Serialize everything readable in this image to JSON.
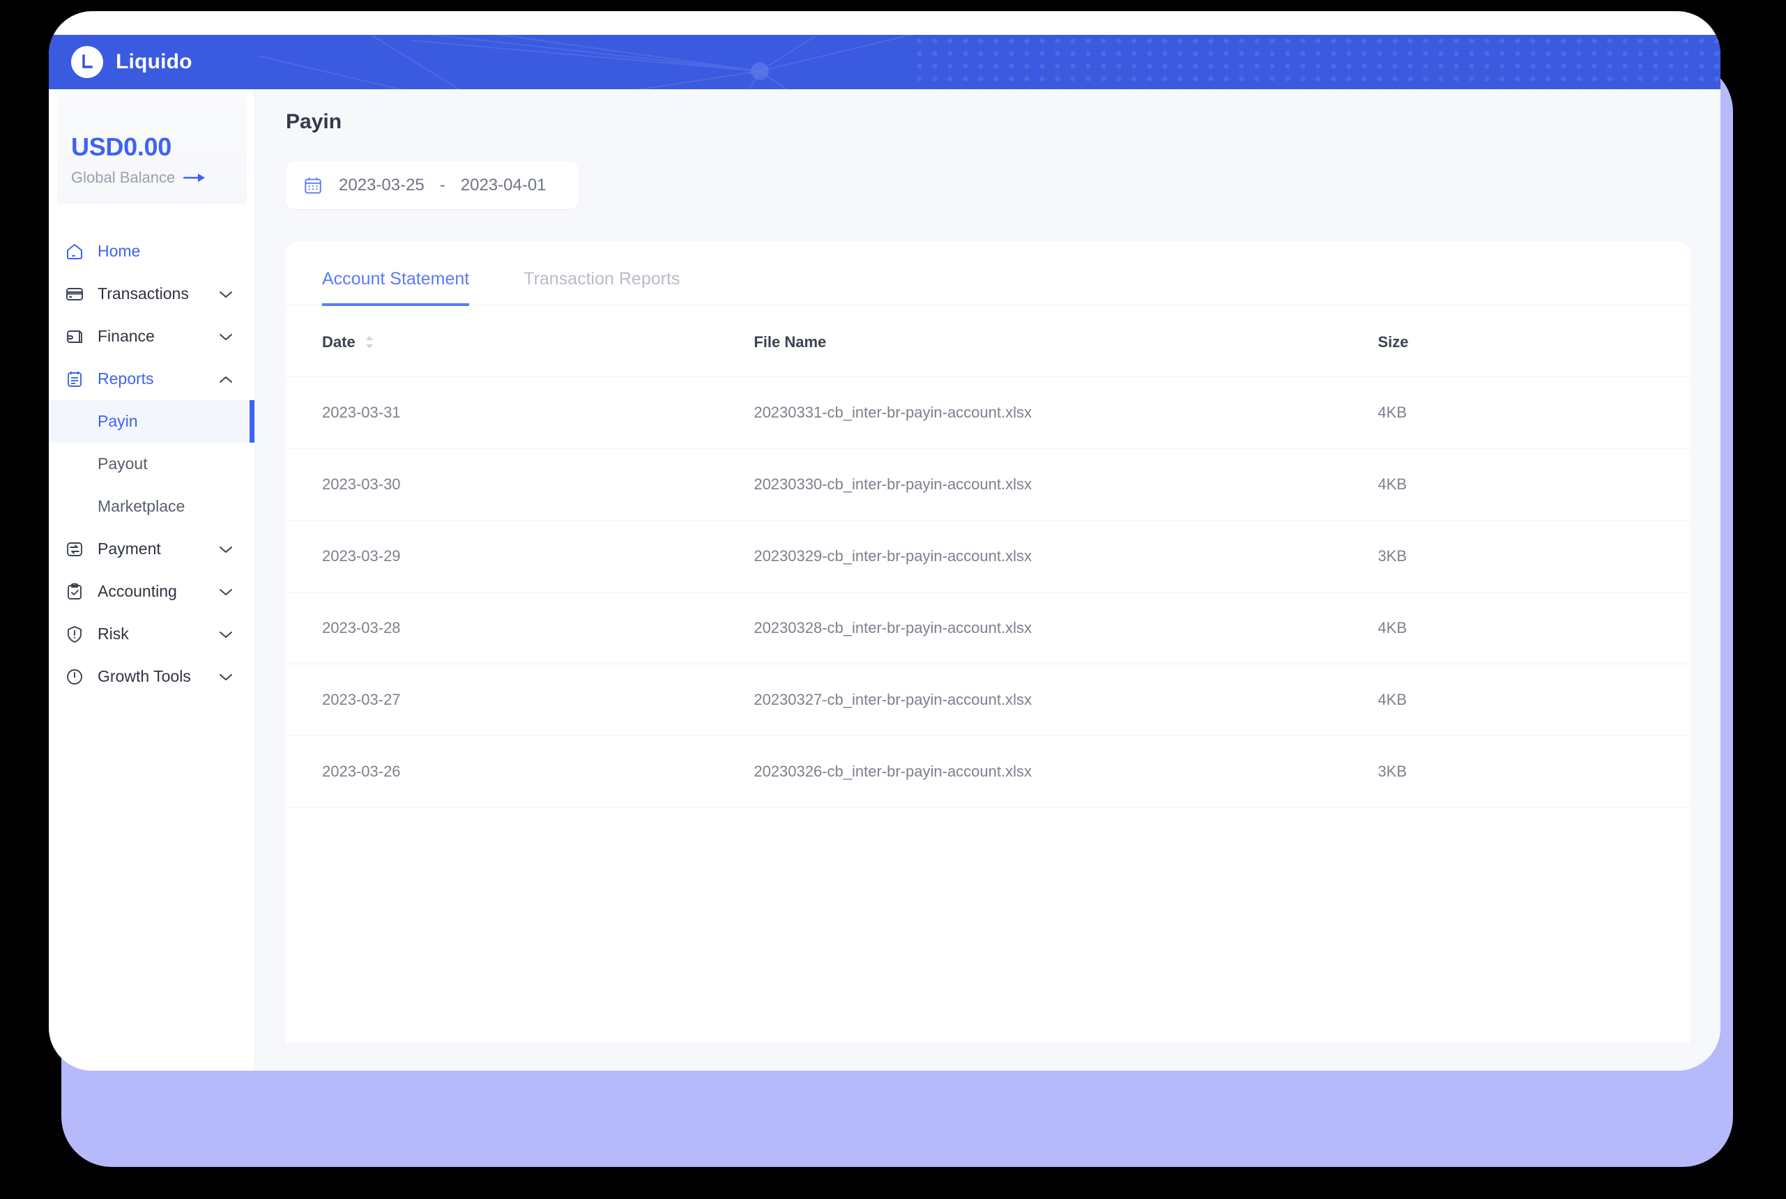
{
  "brand": {
    "name": "Liquido",
    "logo_letter": "L",
    "logo_icon": "liquido-logo-icon"
  },
  "sidebar": {
    "balance": {
      "amount": "USD0.00",
      "label": "Global Balance",
      "arrow_icon": "arrow-right-icon"
    },
    "items": [
      {
        "label": "Home",
        "icon": "home-icon",
        "active": true,
        "chevron": ""
      },
      {
        "label": "Transactions",
        "icon": "card-icon",
        "active": false,
        "chevron": "chevron-down-icon"
      },
      {
        "label": "Finance",
        "icon": "wallet-icon",
        "active": false,
        "chevron": "chevron-down-icon"
      },
      {
        "label": "Reports",
        "icon": "clipboard-list-icon",
        "active": true,
        "chevron": "chevron-up-icon"
      },
      {
        "label": "Payment",
        "icon": "payment-icon",
        "active": false,
        "chevron": "chevron-down-icon"
      },
      {
        "label": "Accounting",
        "icon": "clipboard-check-icon",
        "active": false,
        "chevron": "chevron-down-icon"
      },
      {
        "label": "Risk",
        "icon": "shield-alert-icon",
        "active": false,
        "chevron": "chevron-down-icon"
      },
      {
        "label": "Growth Tools",
        "icon": "growth-icon",
        "active": false,
        "chevron": "chevron-down-icon"
      }
    ],
    "reports_subitems": [
      {
        "label": "Payin",
        "active": true
      },
      {
        "label": "Payout",
        "active": false
      },
      {
        "label": "Marketplace",
        "active": false
      }
    ]
  },
  "main": {
    "page_title": "Payin",
    "date_range": {
      "icon": "calendar-icon",
      "start": "2023-03-25",
      "separator": "-",
      "end": "2023-04-01"
    },
    "tabs": [
      {
        "label": "Account Statement",
        "active": true
      },
      {
        "label": "Transaction Reports",
        "active": false
      }
    ],
    "table": {
      "columns": [
        "Date",
        "File Name",
        "Size"
      ],
      "sort_icon": "sort-arrows-icon",
      "rows": [
        {
          "date": "2023-03-31",
          "file_name": "20230331-cb_inter-br-payin-account.xlsx",
          "size": "4KB"
        },
        {
          "date": "2023-03-30",
          "file_name": "20230330-cb_inter-br-payin-account.xlsx",
          "size": "4KB"
        },
        {
          "date": "2023-03-29",
          "file_name": "20230329-cb_inter-br-payin-account.xlsx",
          "size": "3KB"
        },
        {
          "date": "2023-03-28",
          "file_name": "20230328-cb_inter-br-payin-account.xlsx",
          "size": "4KB"
        },
        {
          "date": "2023-03-27",
          "file_name": "20230327-cb_inter-br-payin-account.xlsx",
          "size": "4KB"
        },
        {
          "date": "2023-03-26",
          "file_name": "20230326-cb_inter-br-payin-account.xlsx",
          "size": "3KB"
        }
      ]
    }
  },
  "colors": {
    "brand_blue": "#3a5ae0",
    "accent_blue": "#3d62f5",
    "tab_blue": "#5a7bf8",
    "shadow_lavender": "#b6bafb",
    "content_bg": "#f6f8fb"
  }
}
